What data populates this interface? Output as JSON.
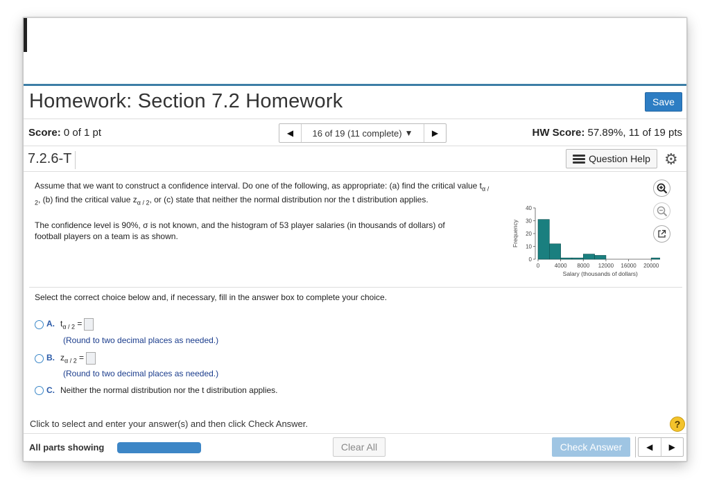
{
  "header": {
    "title": "Homework: Section 7.2 Homework",
    "save_label": "Save"
  },
  "score_row": {
    "score_label": "Score:",
    "score_value": "0 of 1 pt",
    "nav_label": "16 of 19 (11 complete)",
    "hw_score_label": "HW Score:",
    "hw_score_value": "57.89%, 11 of 19 pts"
  },
  "question": {
    "id": "7.2.6-T",
    "help_label": "Question Help",
    "text1_a": "Assume that we want to construct a confidence interval. Do one of the following, as appropriate: (a) find the critical value t",
    "text1_b": ", (b) find the critical value z",
    "text1_c": ", or (c) state that neither the normal distribution nor the t distribution applies.",
    "sub_alpha2": "α / 2",
    "text2": "The confidence level is 90%, σ is not known, and the histogram of 53 player salaries (in thousands of dollars) of football players on a team is as shown.",
    "instruction": "Select the correct choice below and, if necessary, fill in the answer box to complete your choice.",
    "choices": [
      {
        "letter": "A.",
        "var": "t",
        "sub": "α / 2",
        "eq": " =",
        "hint": "(Round to two decimal places as needed.)"
      },
      {
        "letter": "B.",
        "var": "z",
        "sub": "α / 2",
        "eq": " =",
        "hint": "(Round to two decimal places as needed.)"
      },
      {
        "letter": "C.",
        "text": "Neither the normal distribution nor the t distribution applies."
      }
    ]
  },
  "chart_data": {
    "type": "bar",
    "xlabel": "Salary (thousands of dollars)",
    "ylabel": "Frequency",
    "ylim": [
      0,
      40
    ],
    "yticks": [
      0,
      10,
      20,
      30,
      40
    ],
    "xticks": [
      0,
      4000,
      8000,
      12000,
      16000,
      20000
    ],
    "bin_width": 2000,
    "bins": [
      {
        "start": 0,
        "value": 31
      },
      {
        "start": 2000,
        "value": 12
      },
      {
        "start": 4000,
        "value": 1
      },
      {
        "start": 6000,
        "value": 1
      },
      {
        "start": 8000,
        "value": 4
      },
      {
        "start": 10000,
        "value": 3
      },
      {
        "start": 12000,
        "value": 0
      },
      {
        "start": 14000,
        "value": 0
      },
      {
        "start": 16000,
        "value": 0
      },
      {
        "start": 18000,
        "value": 0
      },
      {
        "start": 20000,
        "value": 1
      }
    ],
    "bar_color": "#1a7f7f"
  },
  "footer": {
    "prompt": "Click to select and enter your answer(s) and then click Check Answer.",
    "help_glyph": "?",
    "parts_label": "All parts showing",
    "clear_label": "Clear All",
    "check_label": "Check Answer"
  }
}
